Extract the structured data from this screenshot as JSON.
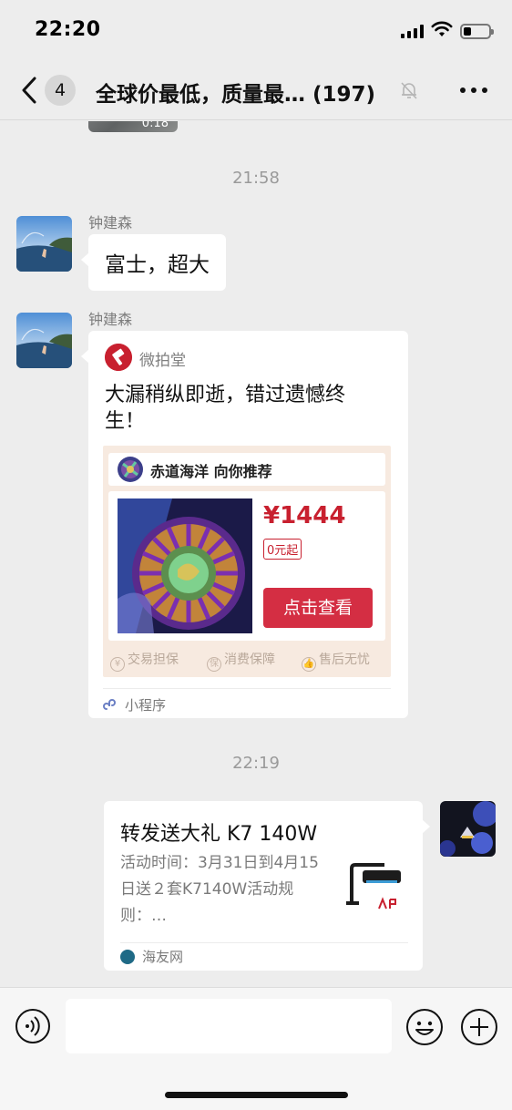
{
  "status_bar": {
    "time": "22:20",
    "battery_level": 0.3
  },
  "nav": {
    "unread_count": "4",
    "title": "全球价最低，质量最… (197)",
    "back_icon": "chevron-left-icon",
    "mute_icon": "bell-slash-icon",
    "more_icon": "more-dots-icon"
  },
  "chat": {
    "partial_video_duration": "0:18",
    "timestamp_1": "21:58",
    "msg1": {
      "sender": "钟建森",
      "text": "富士，超大"
    },
    "msg2": {
      "sender": "钟建森",
      "mini_program": {
        "app_name": "微拍堂",
        "title": "大漏稍纵即逝，错过遗憾终生！",
        "recommender": "赤道海洋 向你推荐",
        "price": "¥1444",
        "start_price": "0元起",
        "cta": "点击查看",
        "guarantees": [
          "交易担保",
          "消费保障",
          "售后无忧"
        ],
        "guarantee_icons": [
          "¥",
          "保",
          "👍"
        ],
        "footer_label": "小程序",
        "brand_color": "#c8202f"
      }
    },
    "timestamp_2": "22:19",
    "msg3": {
      "link_card": {
        "title": "转发送大礼 K7 140W",
        "description": "活动时间：3月31日到4月15日送２套K7140W活动规则：…",
        "source": "海友网"
      }
    }
  },
  "input_bar": {
    "voice_icon": "voice-icon",
    "emoji_icon": "emoji-icon",
    "plus_icon": "plus-circle-icon",
    "value": ""
  }
}
